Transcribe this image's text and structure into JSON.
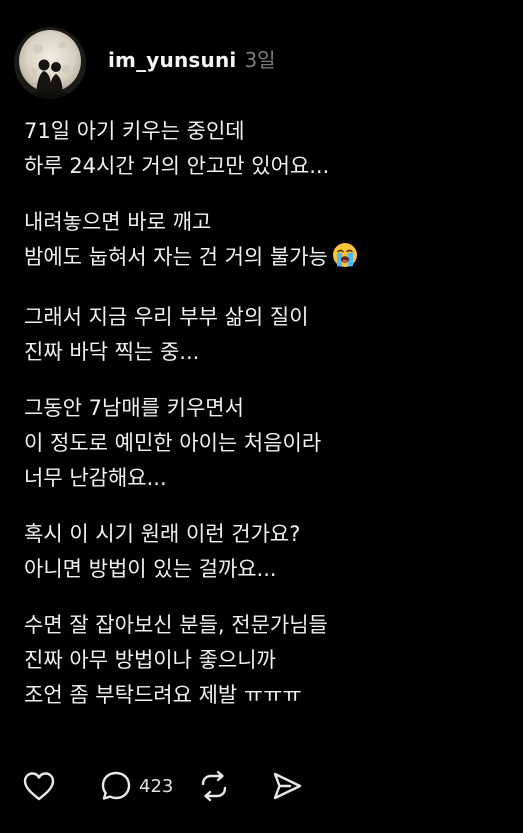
{
  "post": {
    "username": "im_yunsuni",
    "timestamp": "3일",
    "paragraphs": [
      [
        "71일 아기 키우는 중인데",
        "하루 24시간 거의 안고만 있어요..."
      ],
      [
        "내려놓으면 바로 깨고",
        "밤에도 눕혀서 자는 건 거의 불가능"
      ],
      [
        "그래서 지금 우리 부부 삶의 질이",
        "진짜 바닥 찍는 중..."
      ],
      [
        "그동안 7남매를 키우면서",
        "이 정도로 예민한 아이는 처음이라",
        "너무 난감해요..."
      ],
      [
        "혹시 이 시기 원래 이런 건가요?",
        "아니면 방법이 있는 걸까요..."
      ],
      [
        "수면 잘 잡아보신 분들, 전문가님들",
        "진짜 아무 방법이나 좋으니까",
        "조언 좀 부탁드려요 제발 ㅠㅠㅠ"
      ]
    ],
    "emoji_icon": "loudly-crying-face-icon"
  },
  "actions": {
    "like_icon": "heart-icon",
    "reply_icon": "speech-bubble-icon",
    "reply_count": "423",
    "repost_icon": "repost-icon",
    "share_icon": "send-icon"
  },
  "colors": {
    "background": "#000000",
    "text": "#f1f1f1",
    "muted": "#7a7a7a"
  }
}
